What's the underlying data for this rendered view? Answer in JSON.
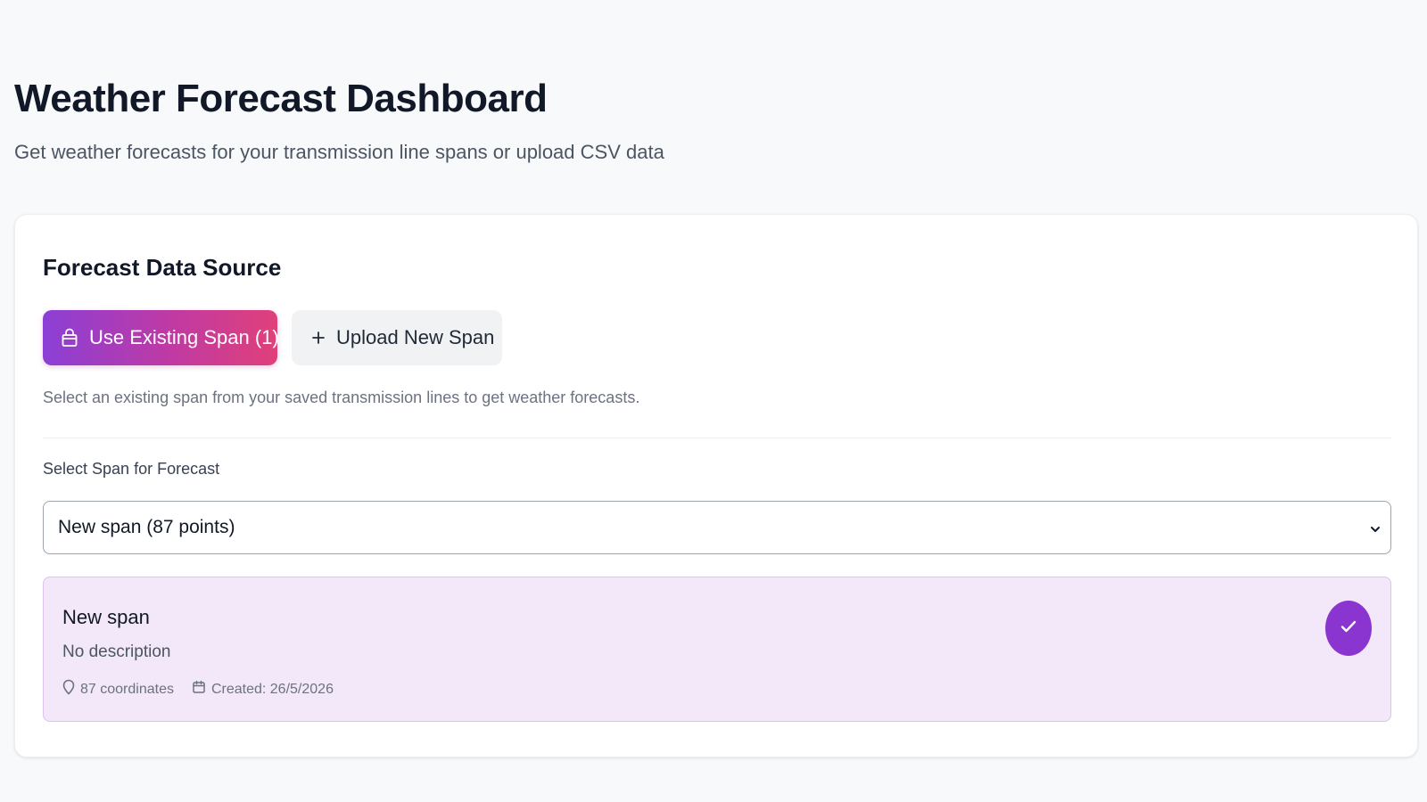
{
  "header": {
    "title": "Weather Forecast Dashboard",
    "subtitle": "Get weather forecasts for your transmission line spans or upload CSV data"
  },
  "source_card": {
    "title": "Forecast Data Source",
    "use_existing_label": "Use Existing Span (1)",
    "upload_new_label": "Upload New Span",
    "helper_text": "Select an existing span from your saved transmission lines to get weather forecasts.",
    "select_label": "Select Span for Forecast",
    "select_value": "New span (87 points)"
  },
  "selected_span": {
    "name": "New span",
    "description": "No description",
    "coordinates": "87 coordinates",
    "created": "Created: 26/5/2026",
    "selected": true
  },
  "icons": {
    "use_existing": "package-icon",
    "upload_new": "plus-icon",
    "select": "chevron-down-icon",
    "coordinates": "map-pin-icon",
    "created": "calendar-icon",
    "selected": "check-icon"
  },
  "colors": {
    "primary_gradient_start": "#8b3fd6",
    "primary_gradient_end": "#e0407a",
    "selected_bg": "#f3e8f9",
    "check_circle": "#8b35d0"
  }
}
